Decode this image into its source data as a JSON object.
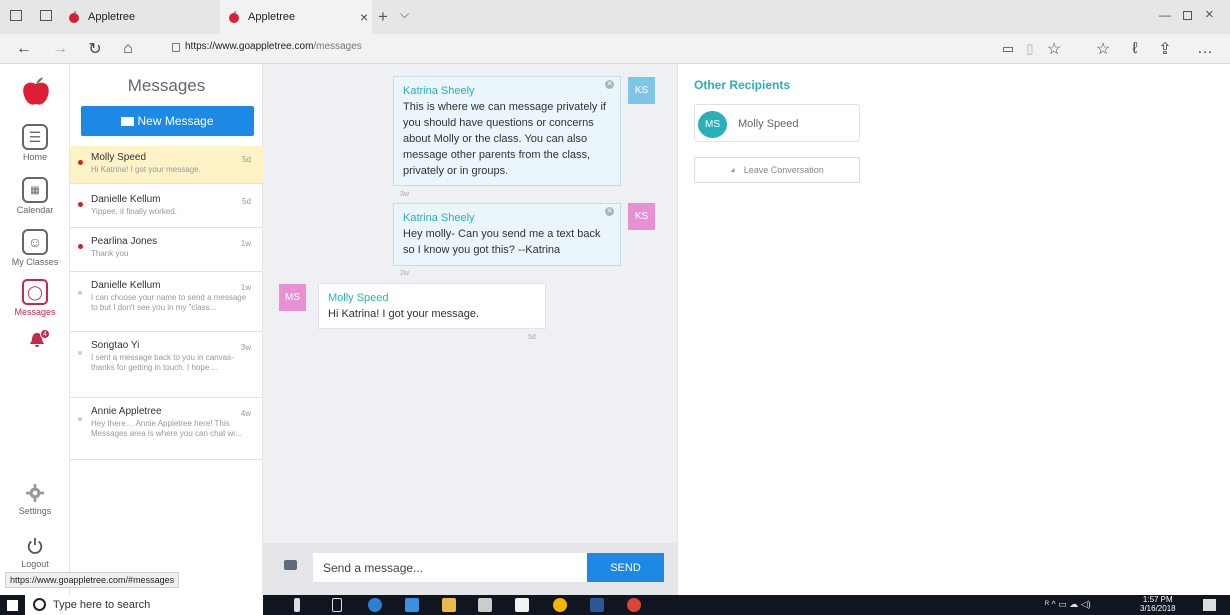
{
  "browser": {
    "tabs": [
      {
        "title": "Appletree"
      },
      {
        "title": "Appletree"
      }
    ],
    "url_host": "https://www.goappletree.com",
    "url_path": "/messages",
    "status_url": "https://www.goappletree.com/#messages"
  },
  "rail": {
    "items": [
      {
        "label": "Home"
      },
      {
        "label": "Calendar"
      },
      {
        "label": "My Classes"
      },
      {
        "label": "Messages"
      },
      {
        "label": "Settings"
      },
      {
        "label": "Logout"
      }
    ],
    "notification_count": "4"
  },
  "messages_list": {
    "title": "Messages",
    "new_message_label": "New Message",
    "conversations": [
      {
        "name": "Molly Speed",
        "time": "5d",
        "preview": "Hi Katrina! I got your message.",
        "unread": true
      },
      {
        "name": "Danielle Kellum",
        "time": "5d",
        "preview": "Yippee, it finally worked.",
        "unread": true
      },
      {
        "name": "Pearlina Jones",
        "time": "1w",
        "preview": "Thank you",
        "unread": true
      },
      {
        "name": "Danielle Kellum",
        "time": "1w",
        "preview": "I can choose your name to send a message to but I don't see you in my \"class...",
        "unread": false
      },
      {
        "name": "Songtao Yi",
        "time": "3w",
        "preview": "I sent a message back to you in canvas- thanks for getting in touch. I hope ...",
        "unread": false
      },
      {
        "name": "Annie Appletree",
        "time": "4w",
        "preview": "Hey there… Annie Appletree here! This Messages area is where you can chat wi...",
        "unread": false
      }
    ]
  },
  "chat": {
    "messages": [
      {
        "sender": "Katrina Sheely",
        "initials": "KS",
        "text": "This is where we can message privately if you should have questions or concerns about Molly or the class. You can also message other parents from the class, privately or in groups.",
        "time": "3w"
      },
      {
        "sender": "Katrina Sheely",
        "initials": "KS",
        "text": "Hey molly- Can you send me a text back so I know you got this? --Katrina",
        "time": "2w"
      },
      {
        "sender": "Molly Speed",
        "initials": "MS",
        "text": "Hi Katrina! I got your message.",
        "time": "5d"
      }
    ],
    "composer_placeholder": "Send a message...",
    "send_label": "SEND"
  },
  "recipients": {
    "title": "Other Recipients",
    "people": [
      {
        "initials": "MS",
        "name": "Molly Speed"
      }
    ],
    "leave_label": "Leave Conversation"
  },
  "taskbar": {
    "search_placeholder": "Type here to search",
    "time": "1:57 PM",
    "date": "3/16/2018"
  },
  "colors": {
    "accent": "#1e88e5",
    "teal": "#2ab0b8",
    "brand_red": "#c6284b",
    "selected_row": "#fdf3c6"
  }
}
